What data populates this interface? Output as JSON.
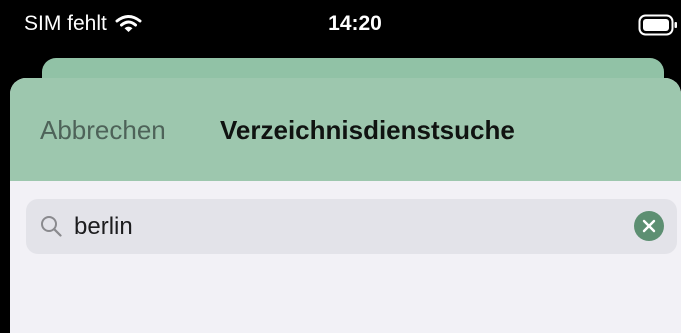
{
  "status_bar": {
    "carrier": "SIM fehlt",
    "time": "14:20",
    "wifi_icon": "wifi-icon",
    "battery_icon": "battery-icon"
  },
  "header": {
    "cancel_label": "Abbrechen",
    "title": "Verzeichnisdienstsuche"
  },
  "search": {
    "value": "berlin",
    "search_icon": "search-icon",
    "clear_icon": "clear-icon"
  },
  "colors": {
    "nav_bar": "#9dc7ae",
    "back_card": "#91c2a6",
    "accent": "#5d8f72",
    "sheet_background": "#f2f1f6",
    "search_field": "#e3e3e9"
  }
}
